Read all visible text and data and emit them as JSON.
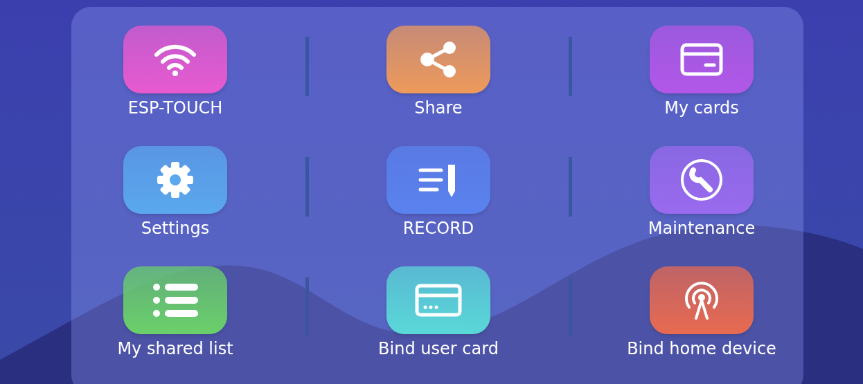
{
  "tiles": [
    {
      "label": "ESP-TOUCH",
      "kind": "wifi",
      "color": "#e85ad0"
    },
    {
      "label": "Share",
      "kind": "share",
      "color": "#ee9a5a"
    },
    {
      "label": "My cards",
      "kind": "card",
      "color": "#b357e8"
    },
    {
      "label": "Settings",
      "kind": "gear",
      "color": "#5aa8ee"
    },
    {
      "label": "RECORD",
      "kind": "record",
      "color": "#5a82ee"
    },
    {
      "label": "Maintenance",
      "kind": "wrench",
      "color": "#9a6aee"
    },
    {
      "label": "My shared list",
      "kind": "list",
      "color": "#6ad06a"
    },
    {
      "label": "Bind user card",
      "kind": "payment",
      "color": "#5ad8d8"
    },
    {
      "label": "Bind home device",
      "kind": "antenna",
      "color": "#e86a50"
    }
  ]
}
